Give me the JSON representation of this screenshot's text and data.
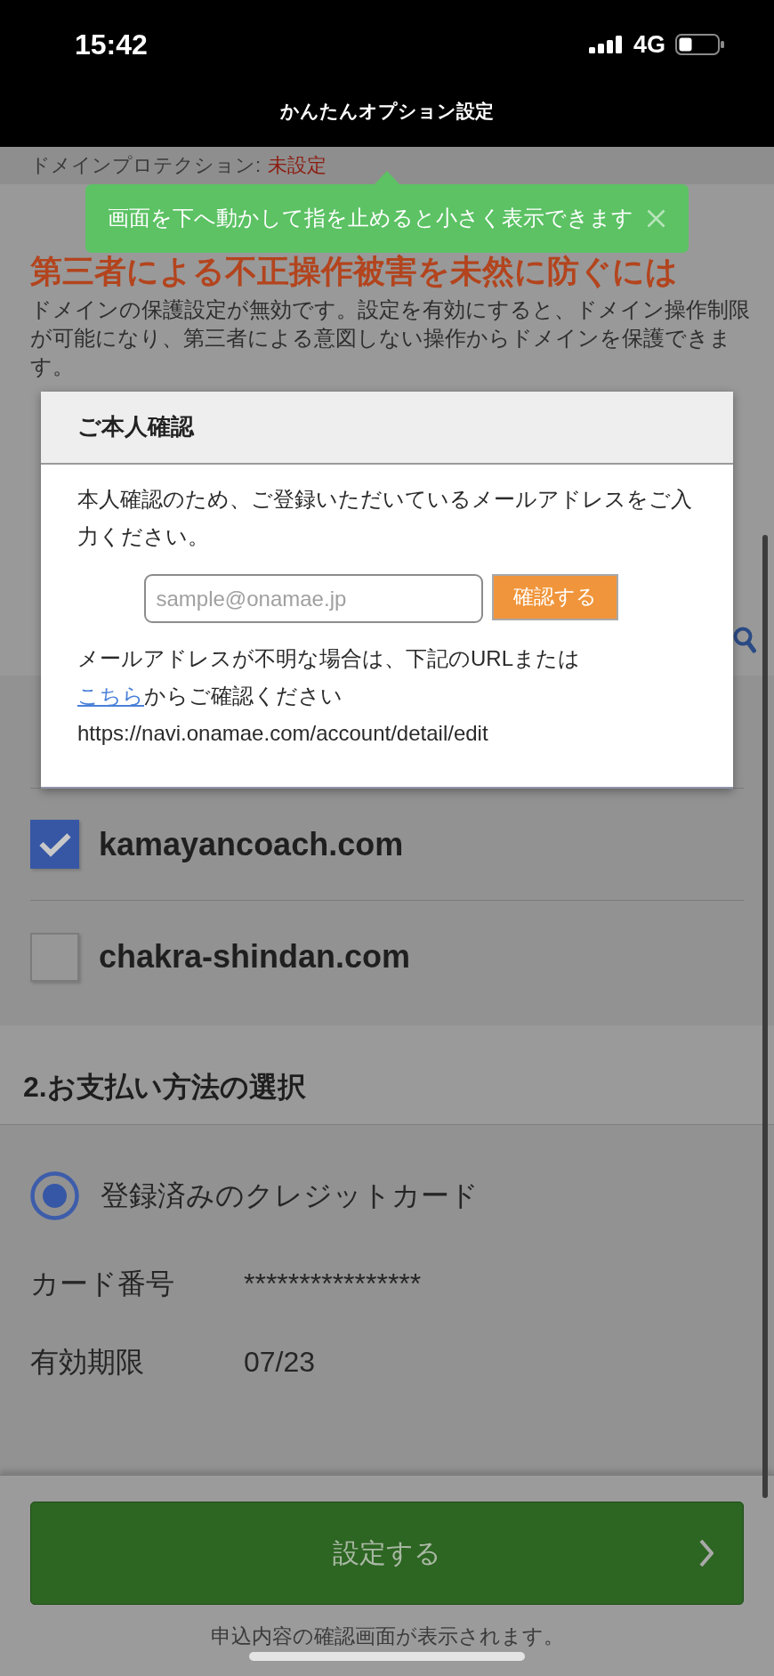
{
  "status_bar": {
    "time": "15:42",
    "network": "4G"
  },
  "header": {
    "title": "かんたんオプション設定"
  },
  "protection": {
    "label": "ドメインプロテクション:",
    "value": "未設定"
  },
  "toast": {
    "text": "画面を下へ動かして指を止めると小さく表示できます"
  },
  "warning": {
    "title": "第三者による不正操作被害を未然に防ぐには",
    "text": "ドメインの保護設定が無効です。設定を有効にすると、ドメイン操作制限が可能になり、第三者による意図しない操作からドメインを保護できます。"
  },
  "dialog": {
    "title": "ご本人確認",
    "message": "本人確認のため、ご登録いただいているメールアドレスをご入力ください。",
    "email_field": {
      "placeholder": "sample@onamae.jp"
    },
    "confirm_button": "確認する",
    "help": {
      "lead": "メールアドレスが不明な場合は、下記のURLまたは",
      "link": "こちら",
      "rest": "からご確認ください",
      "url": "https://navi.onamae.com/account/detail/edit"
    }
  },
  "domains": [
    {
      "name": "kamayancoach.com",
      "checked": true
    },
    {
      "name": "chakra-shindan.com",
      "checked": false
    }
  ],
  "payment": {
    "title": "2.お支払い方法の選択",
    "options": [
      {
        "label": "登録済みのクレジットカード",
        "selected": true
      }
    ],
    "details": [
      {
        "label": "カード番号",
        "value": "****************"
      },
      {
        "label": "有効期限",
        "value": "07/23"
      }
    ]
  },
  "footer": {
    "submit_button": "設定する",
    "note": "申込内容の確認画面が表示されます。"
  }
}
